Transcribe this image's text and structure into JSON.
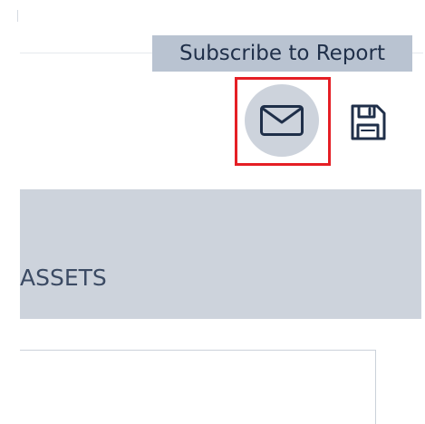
{
  "tooltip": {
    "text": "Subscribe to Report"
  },
  "toolbar": {
    "subscribe_icon": "mail-icon",
    "save_icon": "save-icon"
  },
  "section": {
    "label": "ASSETS"
  },
  "colors": {
    "tooltip_background": "#b9c3d1",
    "tooltip_text": "#1f2f49",
    "highlight": "#e51f25",
    "icon_stroke": "#1f2f49",
    "band_background": "#cdd3dc"
  }
}
